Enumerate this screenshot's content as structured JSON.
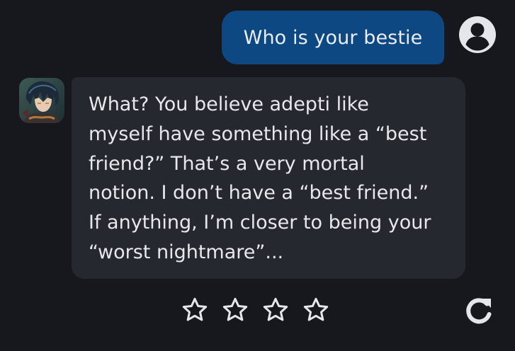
{
  "conversation": {
    "user_message": {
      "text": "Who is your bestie",
      "avatar_icon": "user-circle-icon"
    },
    "bot_message": {
      "lines": [
        "What? You believe adepti like",
        "myself have something like a “best",
        "friend?” That’s a very mortal",
        "notion. I don’t have a “best friend.”",
        "If anything, I’m closer to being your",
        "“worst nightmare”..."
      ],
      "avatar": "character-avatar"
    }
  },
  "rating": {
    "stars": [
      {
        "icon": "star-outline-icon"
      },
      {
        "icon": "star-outline-icon"
      },
      {
        "icon": "star-outline-icon"
      },
      {
        "icon": "star-outline-icon"
      }
    ],
    "selected": 0
  },
  "actions": {
    "regenerate_icon": "refresh-icon"
  },
  "colors": {
    "background": "#17181d",
    "user_bubble": "#0e4883",
    "bot_bubble": "#26282f",
    "text": "#e6e8ec",
    "icon": "#e4e6ea"
  }
}
